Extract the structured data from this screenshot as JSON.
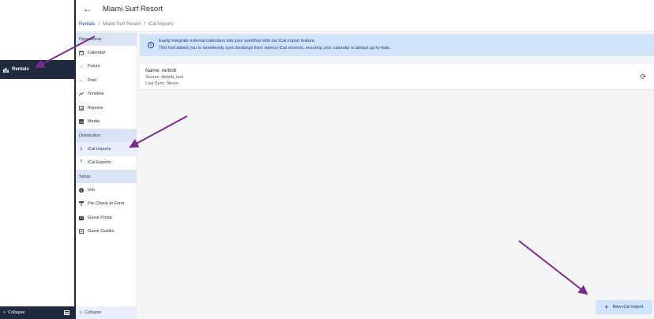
{
  "rail": {
    "rentals_label": "Rentals",
    "collapse_label": "Collapse"
  },
  "header": {
    "back_icon": "←",
    "title": "Miami Surf Resort"
  },
  "breadcrumb": {
    "items": [
      "Rentals",
      "Miami Surf Resort",
      "iCal Imports"
    ],
    "separator": "/"
  },
  "subnav": {
    "sections": [
      {
        "label": "Operational",
        "items": [
          {
            "label": "Calendar",
            "icon": "calendar-icon"
          },
          {
            "label": "Future",
            "icon": "arrow-right-icon"
          },
          {
            "label": "Past",
            "icon": "arrow-left-icon"
          },
          {
            "label": "Timeline",
            "icon": "timeline-icon"
          },
          {
            "label": "Reports",
            "icon": "reports-icon"
          },
          {
            "label": "Media",
            "icon": "media-icon"
          }
        ]
      },
      {
        "label": "Distribution",
        "items": [
          {
            "label": "iCal Imports",
            "icon": "download-icon",
            "active": true
          },
          {
            "label": "iCal Exports",
            "icon": "upload-icon"
          }
        ]
      },
      {
        "label": "Setup",
        "items": [
          {
            "label": "Info",
            "icon": "info-icon"
          },
          {
            "label": "Pre Check-In Form",
            "icon": "form-icon"
          },
          {
            "label": "Guest Portal",
            "icon": "portal-icon"
          },
          {
            "label": "Guest Guides",
            "icon": "guide-icon"
          }
        ]
      }
    ],
    "collapse_label": "Collapse"
  },
  "info": {
    "line1": "Easily integrate external calendars into your workflow with our iCal import feature.",
    "line2": "This tool allows you to seamlessly sync bookings from various iCal sources, ensuring your calendar is always up-to-date."
  },
  "import_card": {
    "name": "Name: Airbnb",
    "source": "Source: Airbnb_test",
    "last_sync": "Last Sync: Never"
  },
  "new_button": {
    "label": "New iCal Import"
  },
  "colors": {
    "rail_dark": "#1f2a3d",
    "section_bg": "#dbe4f4",
    "info_bg": "#cfe3fb",
    "arrow": "#7b2a8e"
  }
}
